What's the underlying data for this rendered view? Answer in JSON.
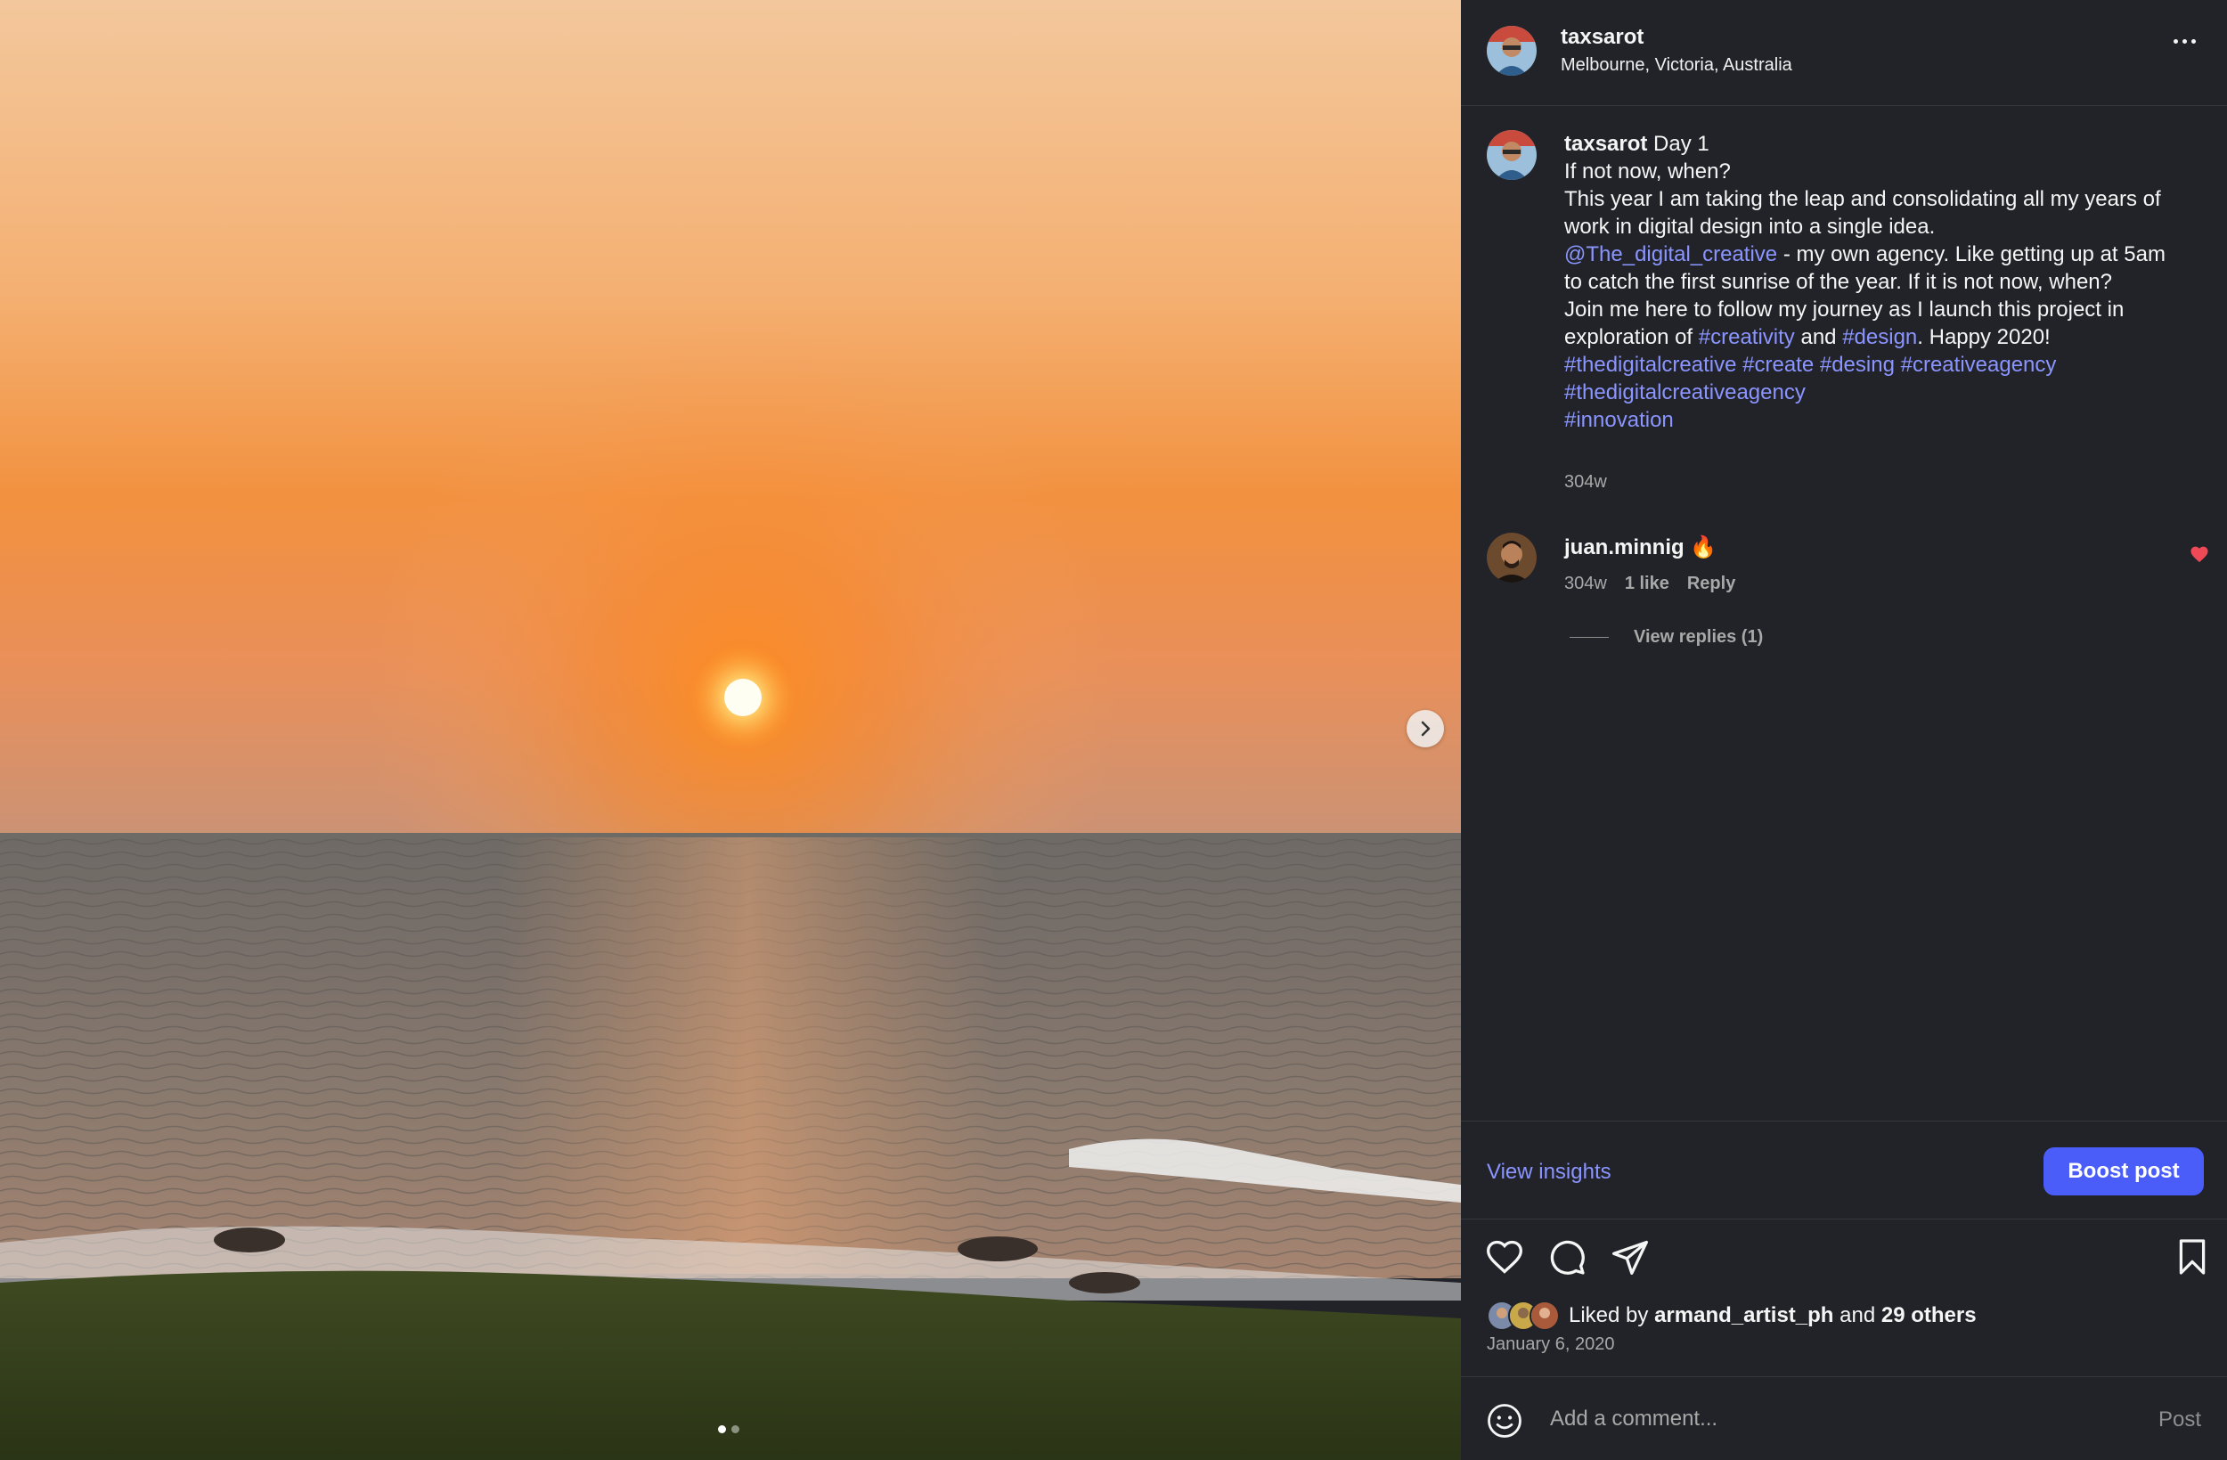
{
  "post": {
    "username": "taxsarot",
    "location": "Melbourne, Victoria, Australia",
    "caption": {
      "username": "taxsarot",
      "line1": "Day 1",
      "line2": "If not now, when?",
      "line3": "This year I am taking the leap and consolidating all my years of work in digital design into a single idea.",
      "mention": "@The_digital_creative",
      "line4": " - my own agency. Like getting up at 5am to catch the first sunrise of the year. If it is not now, when?",
      "line5_a": "Join me here to follow my journey as I launch this project in exploration of ",
      "hashtag_creativity": "#creativity",
      "line5_b": " and ",
      "hashtag_design": "#design",
      "line5_c": ". Happy 2020!",
      "hashtag_1": "#thedigitalcreative",
      "hashtag_2": "#create",
      "hashtag_3": "#desing",
      "hashtag_4": "#creativeagency",
      "hashtag_5": "#thedigitalcreativeagency",
      "hashtag_6": "#innovation",
      "time": "304w"
    },
    "comment": {
      "username": "juan.minnig",
      "text": "🔥",
      "time": "304w",
      "likes": "1 like",
      "reply": "Reply",
      "view_replies": "View replies (1)"
    },
    "insights_label": "View insights",
    "boost_label": "Boost post",
    "likes": {
      "prefix": "Liked by",
      "user": "armand_artist_ph",
      "middle": "and",
      "others": "29 others"
    },
    "date": "January 6, 2020",
    "comment_placeholder": "Add a comment...",
    "post_label": "Post"
  },
  "carousel": {
    "current": 1,
    "total": 2
  },
  "colors": {
    "panel_bg": "#212328",
    "link": "#8b95ff",
    "boost": "#4a5df9",
    "heart": "#ed4956"
  },
  "icons": [
    "more-icon",
    "chevron-right-icon",
    "heart-icon",
    "comment-icon",
    "share-icon",
    "bookmark-icon",
    "emoji-icon"
  ]
}
